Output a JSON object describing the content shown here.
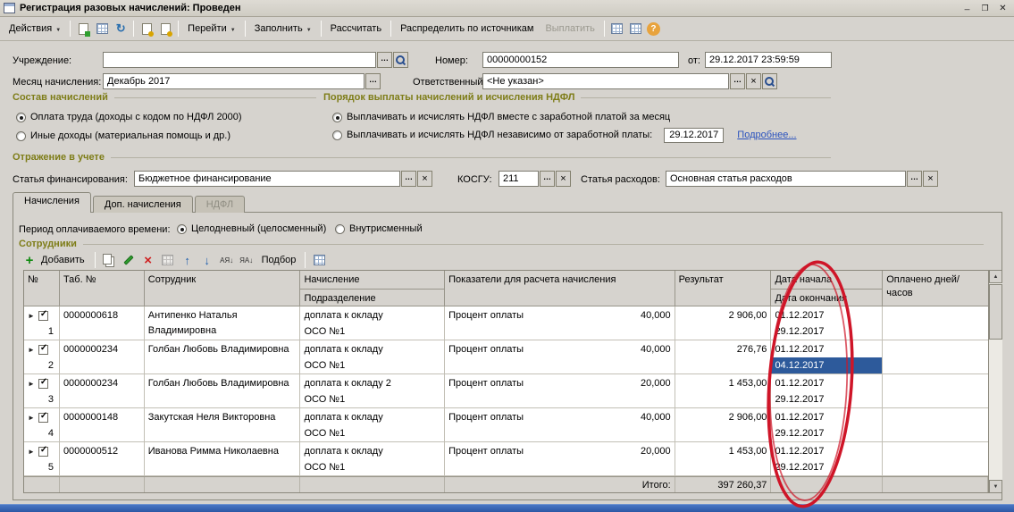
{
  "win": {
    "title": "Регистрация разовых начислений: Проведен"
  },
  "toolbar": {
    "actions": "Действия",
    "goto": "Перейти",
    "fill": "Заполнить",
    "calculate": "Рассчитать",
    "distribute": "Распределить по источникам",
    "pay": "Выплатить"
  },
  "fields": {
    "institution": {
      "label": "Учреждение:",
      "value": ""
    },
    "number": {
      "label": "Номер:",
      "value": "00000000152"
    },
    "date_from": {
      "label": "от:",
      "value": "29.12.2017 23:59:59"
    },
    "month": {
      "label": "Месяц начисления:",
      "value": "Декабрь 2017"
    },
    "responsible": {
      "label": "Ответственный:",
      "value": "<Не указан>"
    }
  },
  "sections": {
    "composition": {
      "title": "Состав начислений",
      "option1": "Оплата труда (доходы с кодом по НДФЛ 2000)",
      "option2": "Иные доходы (материальная помощь и др.)"
    },
    "payment": {
      "title": "Порядок выплаты начислений и исчисления НДФЛ",
      "option1": "Выплачивать и исчислять НДФЛ вместе с заработной платой за месяц",
      "option2": "Выплачивать и исчислять НДФЛ независимо от заработной платы:",
      "date": "29.12.2017",
      "more": "Подробнее..."
    },
    "accounting": {
      "title": "Отражение в учете",
      "financing_label": "Статья финансирования:",
      "financing_value": "Бюджетное финансирование",
      "kosgu_label": "КОСГУ:",
      "kosgu_value": "211",
      "expense_label": "Статья расходов:",
      "expense_value": "Основная статья расходов"
    }
  },
  "tabs": {
    "accruals": "Начисления",
    "additional": "Доп. начисления",
    "ndfl": "НДФЛ"
  },
  "period": {
    "label": "Период оплачиваемого времени:",
    "option1": "Целодневный (целосменный)",
    "option2": "Внутрисменный"
  },
  "emp": {
    "title": "Сотрудники",
    "add": "Добавить",
    "pick": "Подбор",
    "headers": {
      "num": "№",
      "tab_no": "Таб. №",
      "employee": "Сотрудник",
      "accrual": "Начисление",
      "department": "Подразделение",
      "indicators": "Показатели для расчета начисления",
      "result": "Результат",
      "date_start": "Дата начала",
      "date_end": "Дата окончания",
      "paid": "Оплачено дней/часов"
    },
    "rows": [
      {
        "num": "1",
        "tab_no": "0000000618",
        "employee": "Антипенко Наталья Владимировна",
        "accrual": "доплата к окладу",
        "department": "ОСО №1",
        "indicator": "Процент оплаты",
        "indicator_value": "40,000",
        "result": "2 906,00",
        "date_start": "01.12.2017",
        "date_end": "29.12.2017"
      },
      {
        "num": "2",
        "tab_no": "0000000234",
        "employee": "Голбан Любовь Владимировна",
        "accrual": "доплата к окладу",
        "department": "ОСО №1",
        "indicator": "Процент оплаты",
        "indicator_value": "40,000",
        "result": "276,76",
        "date_start": "01.12.2017",
        "date_end": "04.12.2017"
      },
      {
        "num": "3",
        "tab_no": "0000000234",
        "employee": "Голбан Любовь Владимировна",
        "accrual": "доплата к окладу 2",
        "department": "ОСО №1",
        "indicator": "Процент оплаты",
        "indicator_value": "20,000",
        "result": "1 453,00",
        "date_start": "01.12.2017",
        "date_end": "29.12.2017"
      },
      {
        "num": "4",
        "tab_no": "0000000148",
        "employee": "Закутская Неля Викторовна",
        "accrual": "доплата к окладу",
        "department": "ОСО №1",
        "indicator": "Процент оплаты",
        "indicator_value": "40,000",
        "result": "2 906,00",
        "date_start": "01.12.2017",
        "date_end": "29.12.2017"
      },
      {
        "num": "5",
        "tab_no": "0000000512",
        "employee": "Иванова Римма Николаевна",
        "accrual": "доплата к окладу",
        "department": "ОСО №1",
        "indicator": "Процент оплаты",
        "indicator_value": "20,000",
        "result": "1 453,00",
        "date_start": "01.12.2017",
        "date_end": "29.12.2017"
      }
    ],
    "total_label": "Итого:",
    "total_value": "397 260,37"
  },
  "colors": {
    "selection": "#2d5a9b",
    "annotation": "#cf1528",
    "section_title": "#7e7d18",
    "link": "#2a52be",
    "statusbar": "#2c57a4"
  }
}
